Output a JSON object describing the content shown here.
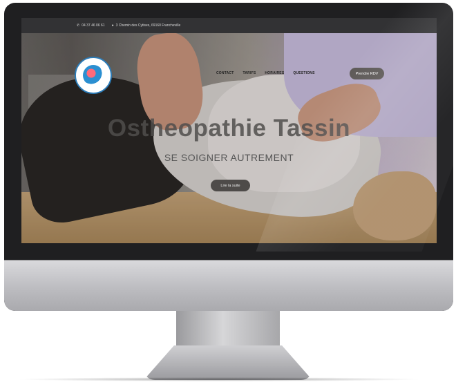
{
  "topbar": {
    "phone": "04 37 46 06 61",
    "address": "3 Chemin des Cytises, 69160 Francheville"
  },
  "icons": {
    "phone": "phone-icon",
    "location": "map-pin-icon"
  },
  "nav": {
    "items": [
      {
        "label": "CONTACT"
      },
      {
        "label": "TARIFS"
      },
      {
        "label": "HORAIRES"
      },
      {
        "label": "QUESTIONS"
      }
    ],
    "cta_label": "Prendre RDV"
  },
  "hero": {
    "title": "Ostheopathie Tassin",
    "subtitle": "SE SOIGNER AUTREMENT",
    "button_label": "Lire la suite"
  }
}
